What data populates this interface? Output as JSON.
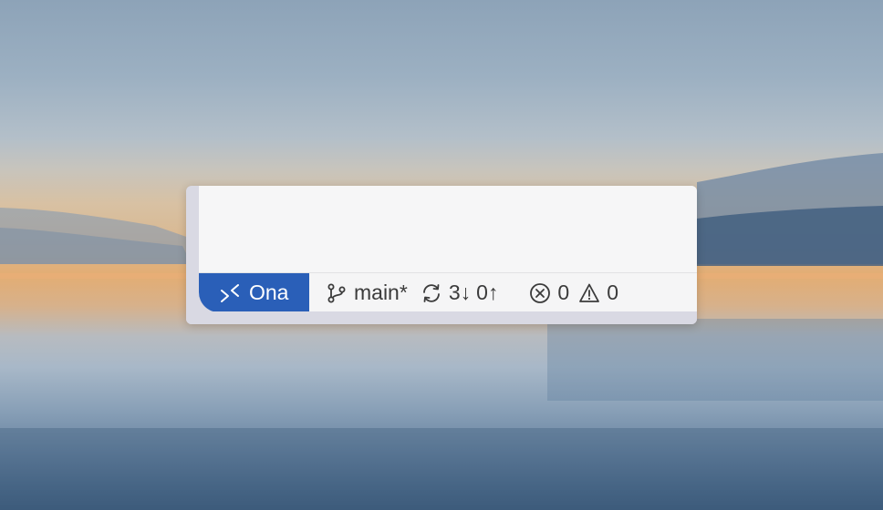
{
  "statusbar": {
    "remote": {
      "label": "Ona",
      "icon": "remote-icon",
      "color": "#2a5fb8"
    },
    "branch": {
      "label": "main*",
      "icon": "git-branch-icon"
    },
    "sync": {
      "incoming": "3↓",
      "outgoing": "0↑",
      "icon": "sync-icon"
    },
    "problems": {
      "errors": "0",
      "warnings": "0",
      "error_icon": "error-icon",
      "warning_icon": "warning-icon"
    }
  }
}
